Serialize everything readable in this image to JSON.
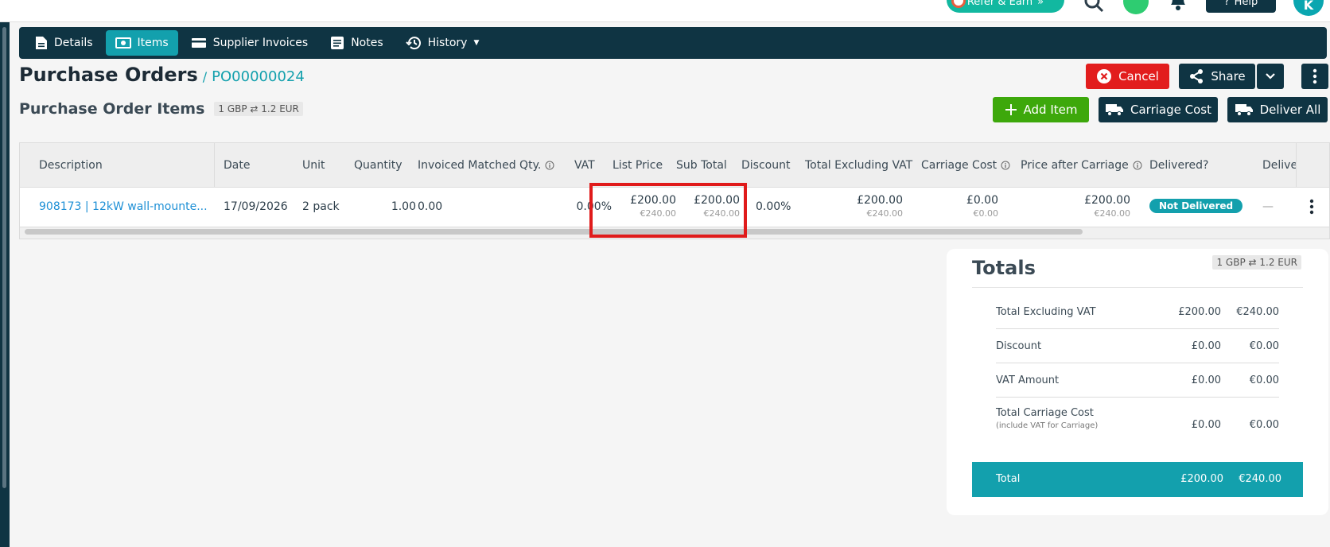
{
  "topbar": {
    "refer_label": "Refer & Earn",
    "help_label": "Help",
    "avatar_initial": "K"
  },
  "tabs": [
    {
      "label": "Details",
      "icon": "document-icon",
      "active": false
    },
    {
      "label": "Items",
      "icon": "money-icon",
      "active": true
    },
    {
      "label": "Supplier Invoices",
      "icon": "card-icon",
      "active": false
    },
    {
      "label": "Notes",
      "icon": "notes-icon",
      "active": false
    },
    {
      "label": "History",
      "icon": "history-icon",
      "active": false
    }
  ],
  "header": {
    "title": "Purchase Orders",
    "separator": "/",
    "po_number": "PO00000024",
    "section_title": "Purchase Order Items",
    "rate": "1 GBP ⇄ 1.2 EUR"
  },
  "actions": {
    "cancel": "Cancel",
    "share": "Share",
    "add_item": "Add Item",
    "carriage_cost": "Carriage Cost",
    "deliver_all": "Deliver All"
  },
  "table": {
    "columns": [
      "Description",
      "Date",
      "Unit",
      "Quantity",
      "Invoiced Matched Qty.",
      "VAT",
      "List Price",
      "Sub Total",
      "Discount",
      "Total Excluding VAT",
      "Carriage Cost",
      "Price after Carriage",
      "Delivered?",
      "Deliver"
    ],
    "row": {
      "description": "908173 | 12kW wall-mounte...",
      "date": "17/09/2026",
      "unit": "2 pack",
      "quantity": "1.00",
      "invoiced_matched_qty": "0.00",
      "vat": "0.00%",
      "list_price_gbp": "£200.00",
      "list_price_eur": "€240.00",
      "sub_total_gbp": "£200.00",
      "sub_total_eur": "€240.00",
      "discount": "0.00%",
      "total_excl_vat_gbp": "£200.00",
      "total_excl_vat_eur": "€240.00",
      "carriage_gbp": "£0.00",
      "carriage_eur": "€0.00",
      "price_after_carriage_gbp": "£200.00",
      "price_after_carriage_eur": "€240.00",
      "delivered": "Not Delivered",
      "deliver": "—"
    }
  },
  "totals": {
    "title": "Totals",
    "rate": "1 GBP ⇄ 1.2 EUR",
    "rows": [
      {
        "label": "Total Excluding VAT",
        "gbp": "£200.00",
        "eur": "€240.00"
      },
      {
        "label": "Discount",
        "gbp": "£0.00",
        "eur": "€0.00"
      },
      {
        "label": "VAT Amount",
        "gbp": "£0.00",
        "eur": "€0.00"
      },
      {
        "label": "Total Carriage Cost",
        "sublabel": "(include VAT for Carriage)",
        "gbp": "£0.00",
        "eur": "€0.00"
      }
    ],
    "total": {
      "label": "Total",
      "gbp": "£200.00",
      "eur": "€240.00"
    }
  },
  "colors": {
    "navy": "#0f3443",
    "teal": "#13a0ad",
    "red": "#e21d1d",
    "green": "#3da80b",
    "link": "#1e90d6"
  }
}
